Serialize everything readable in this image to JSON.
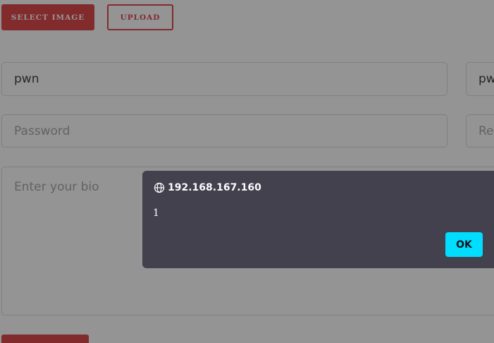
{
  "toolbar": {
    "select_image_label": "SELECT IMAGE",
    "upload_label": "UPLOAD"
  },
  "form": {
    "username_value": "pwn",
    "second_name_value": "pw",
    "password_placeholder": "Password",
    "repeat_password_placeholder": "Re",
    "bio_placeholder": "Enter your bio"
  },
  "dialog": {
    "origin": "192.168.167.160",
    "message": "1",
    "ok_label": "OK",
    "icon": "globe-icon"
  },
  "colors": {
    "accent": "#e14a4f",
    "dialog_bg": "#42414d",
    "ok_button": "#00ddff"
  }
}
